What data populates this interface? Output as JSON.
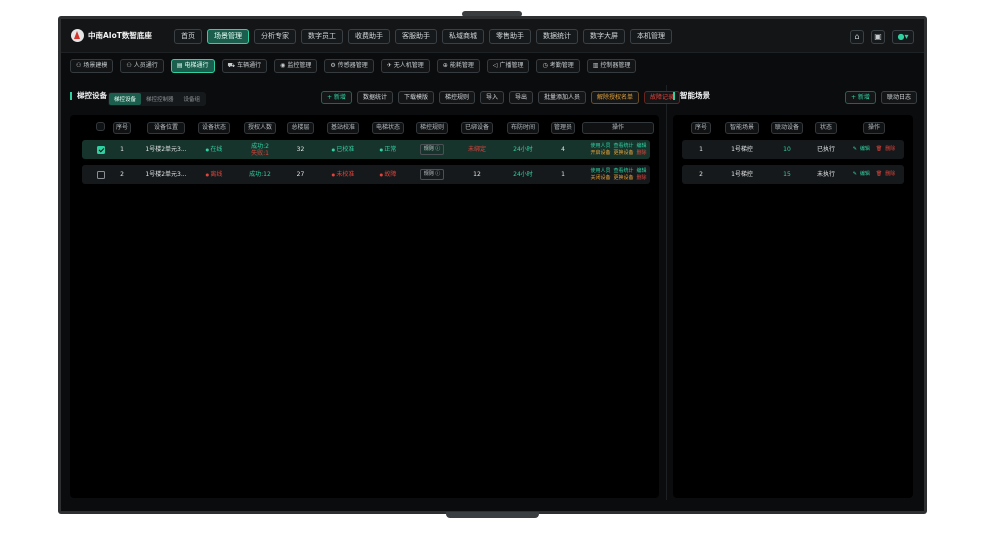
{
  "app": {
    "title": "中南AIoT数智底座"
  },
  "main_nav": [
    "首页",
    "场景管理",
    "分析专家",
    "数字员工",
    "收费助手",
    "客服助手",
    "私域商城",
    "零售助手",
    "数据统计",
    "数字大屏",
    "本机管理"
  ],
  "main_nav_active": 1,
  "sub_nav": [
    {
      "label": "场景建模",
      "icon": "⚇"
    },
    {
      "label": "人员通行",
      "icon": "⚇"
    },
    {
      "label": "电梯通行",
      "icon": "▤"
    },
    {
      "label": "车辆通行",
      "icon": "⛟"
    },
    {
      "label": "监控管理",
      "icon": "◉"
    },
    {
      "label": "传感器管理",
      "icon": "⚙"
    },
    {
      "label": "无人机管理",
      "icon": "✈"
    },
    {
      "label": "能耗管理",
      "icon": "⊕"
    },
    {
      "label": "广播管理",
      "icon": "◁"
    },
    {
      "label": "考勤管理",
      "icon": "◷"
    },
    {
      "label": "控制器管理",
      "icon": "▥"
    }
  ],
  "sub_nav_active": 2,
  "left": {
    "title": "梯控设备",
    "tabs": [
      "梯控设备",
      "梯控控制器",
      "设备组"
    ],
    "actions": [
      {
        "label": "+ 新增",
        "style": "green"
      },
      {
        "label": "数据统计",
        "style": "normal"
      },
      {
        "label": "下载模版",
        "style": "normal"
      },
      {
        "label": "梯控规则",
        "style": "normal"
      },
      {
        "label": "导入",
        "style": "normal"
      },
      {
        "label": "导出",
        "style": "normal"
      },
      {
        "label": "批量添加人员",
        "style": "normal"
      },
      {
        "label": "解除授权名单",
        "style": "orange"
      },
      {
        "label": "故障记录",
        "style": "red"
      }
    ],
    "columns": [
      "",
      "序号",
      "设备位置",
      "设备状态",
      "授权人数",
      "总楼层",
      "基站校准",
      "电梯状态",
      "梯控规则",
      "已绑设备",
      "布防时间",
      "管理员",
      "操作"
    ],
    "rows": [
      {
        "selected": true,
        "no": "1",
        "location": "1号楼2单元3...",
        "status": "在线",
        "auth_1": "成功:2",
        "auth_2": "失败:1",
        "floors": "32",
        "calib": "已校准",
        "elevator": "正常",
        "rule": "规则 ⓘ",
        "bound": "未绑定",
        "time": "24小时",
        "admin": "4",
        "ops_1": [
          "使用人员",
          "查看统计",
          "编辑"
        ],
        "ops_2": [
          "开启设备",
          "更换设备",
          "删除"
        ]
      },
      {
        "selected": false,
        "no": "2",
        "location": "1号楼2单元3...",
        "status": "离线",
        "auth_1": "成功:12",
        "auth_2": "",
        "floors": "27",
        "calib": "未校准",
        "elevator": "故障",
        "rule": "规则 ⓘ",
        "bound": "12",
        "time": "24小时",
        "admin": "1",
        "ops_1": [
          "使用人员",
          "查看统计",
          "编辑"
        ],
        "ops_2": [
          "关闭设备",
          "更换设备",
          "删除"
        ]
      }
    ]
  },
  "right": {
    "title": "智能场景",
    "actions": [
      {
        "label": "+ 新增",
        "style": "green"
      },
      {
        "label": "联动日志",
        "style": "normal"
      }
    ],
    "columns": [
      "序号",
      "智能场景",
      "联动设备",
      "状态",
      "操作"
    ],
    "rows": [
      {
        "no": "1",
        "scene": "1号梯控",
        "devices": "10",
        "state": "已执行",
        "edit": "编辑",
        "del": "删除"
      },
      {
        "no": "2",
        "scene": "1号梯控",
        "devices": "15",
        "state": "未执行",
        "edit": "编辑",
        "del": "删除"
      }
    ]
  },
  "colors": {
    "accent": "#2fd1a2",
    "danger": "#e0443c",
    "warning": "#e5a23a",
    "background": "#0b0c0d"
  }
}
